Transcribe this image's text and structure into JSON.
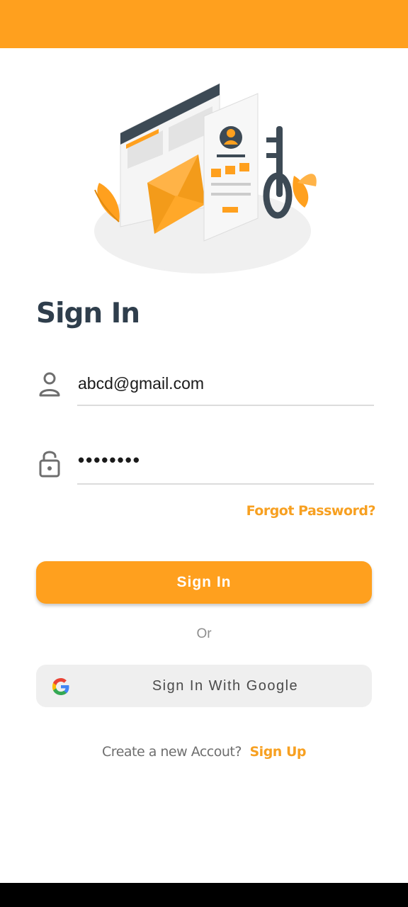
{
  "colors": {
    "accent": "#ffa01e",
    "title": "#2f3e4c",
    "link": "#f7a021"
  },
  "illustration": {
    "icon": "login-security-illustration"
  },
  "title": "Sign In",
  "email_field": {
    "icon": "person-icon",
    "value": "abcd@gmail.com"
  },
  "password_field": {
    "icon": "lock-icon",
    "value": "••••••••"
  },
  "forgot_password": "Forgot Password?",
  "sign_in_button": "Sign In",
  "divider_text": "Or",
  "google_button": {
    "icon": "google-icon",
    "label": "Sign In With Google"
  },
  "signup": {
    "prompt": "Create a new Accout?",
    "link": "Sign Up"
  }
}
